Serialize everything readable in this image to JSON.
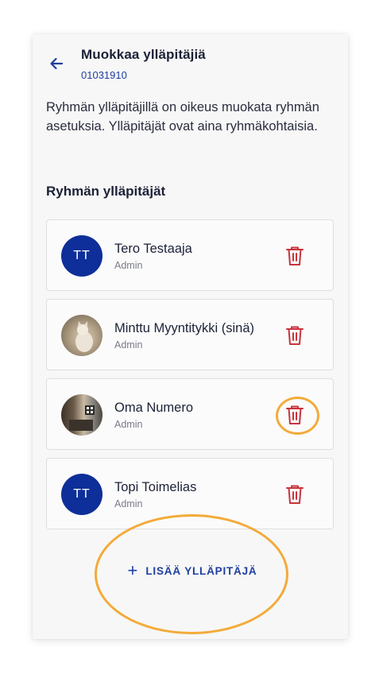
{
  "header": {
    "title": "Muokkaa ylläpitäjiä",
    "subtitle": "01031910",
    "back_icon": "arrow-left-icon"
  },
  "intro_text": "Ryhmän ylläpitäjillä on oikeus muokata ryhmän asetuksia. Ylläpitäjät ovat aina ryhmäkohtaisia.",
  "section_title": "Ryhmän ylläpitäjät",
  "admins": [
    {
      "name": "Tero Testaaja",
      "role": "Admin",
      "avatar_type": "initials",
      "initials": "TT"
    },
    {
      "name": "Minttu Myyntitykki (sinä)",
      "role": "Admin",
      "avatar_type": "photo"
    },
    {
      "name": "Oma Numero",
      "role": "Admin",
      "avatar_type": "photo"
    },
    {
      "name": "Topi Toimelias",
      "role": "Admin",
      "avatar_type": "initials",
      "initials": "TT"
    }
  ],
  "add_button": {
    "icon": "+",
    "label": "LISÄÄ YLLÄPITÄJÄ"
  },
  "colors": {
    "primary": "#1f3fa0",
    "avatar_bg": "#0e2f99",
    "delete": "#c8343b",
    "highlight": "#f3ab39"
  }
}
